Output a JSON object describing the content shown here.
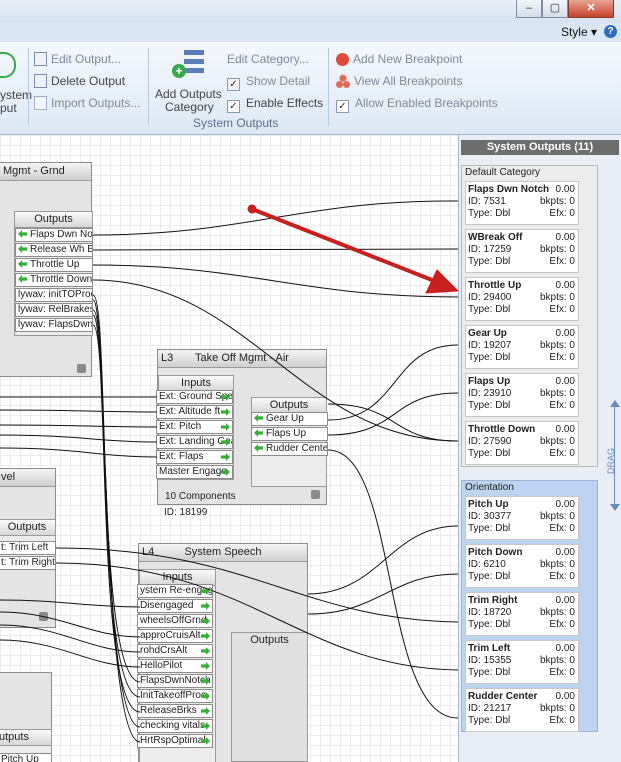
{
  "window": {
    "min": "–",
    "max": "▢",
    "close": "✕"
  },
  "menubar": {
    "style": "Style",
    "help": "?"
  },
  "ribbon": {
    "sys_partial_1": "ystem",
    "sys_partial_2": "put",
    "edit_output": "Edit Output...",
    "delete_output": "Delete Output",
    "import_outputs": "Import Outputs...",
    "add_outputs_category": "Add Outputs",
    "add_outputs_category_2": "Category",
    "edit_category": "Edit Category...",
    "show_detail": "Show Detail",
    "enable_effects": "Enable Effects",
    "add_new_breakpoint": "Add New Breakpoint",
    "view_all_breakpoints": "View All Breakpoints",
    "allow_enabled_breakpoints": "Allow Enabled Breakpoints",
    "group_label": "System Outputs",
    "show_detail_checked": false,
    "enable_effects_checked": true,
    "allow_enabled_checked": true
  },
  "nodes": {
    "grnd": {
      "title": "Mgmt - Grnd",
      "outputs_label": "Outputs",
      "outputs": [
        "Flaps Dwn Notch",
        "Release Wh Brk",
        "Throttle Up",
        "Throttle Down",
        "lywav: initTOProc",
        "lywav: RelBrakes",
        "lywav: FlapsDwn"
      ]
    },
    "l3": {
      "id": "L3",
      "title": "Take Off Mgmt - Air",
      "inputs_label": "Inputs",
      "inputs": [
        "Ext: Ground Speed",
        "Ext: Altitude ft",
        "Ext: Pitch",
        "Ext: Landing Gear",
        "Ext: Flaps",
        "Master Engage"
      ],
      "outputs_label": "Outputs",
      "outputs": [
        "Gear Up",
        "Flaps Up",
        "Rudder Center"
      ],
      "components": "10 Components",
      "node_id": "ID: 18199"
    },
    "vel": {
      "title": "vel",
      "outputs_label": "Outputs",
      "outputs": [
        "t: Trim Left",
        "t: Trim Right"
      ]
    },
    "l4": {
      "id": "L4",
      "title": "System Speech",
      "inputs_label": "Inputs",
      "inputs": [
        "ystem Re-engage",
        "Disengaged",
        "wheelsOffGrnd",
        "approCruisAlt",
        "rohdCrsAlt",
        "HelloPilot",
        "FlapsDwnNotch",
        "InitTakeoffProc",
        "ReleaseBrks",
        "checking vitals",
        "HrtRspOptimal"
      ],
      "outputs_label": "Outputs"
    },
    "bottom": {
      "outputs_label": "utputs",
      "outputs": [
        "Pitch Up"
      ]
    }
  },
  "sidebar": {
    "title": "System Outputs (11)",
    "drag": "DRAG",
    "groups": [
      {
        "name": "Default Category",
        "items": [
          {
            "name": "Flaps Dwn Notch",
            "value": "0.00",
            "id": "ID: 7531",
            "bkpts": "bkpts: 0",
            "type": "Type: Dbl",
            "efx": "Efx: 0"
          },
          {
            "name": "WBreak Off",
            "value": "0.00",
            "id": "ID: 17259",
            "bkpts": "bkpts: 0",
            "type": "Type: Dbl",
            "efx": "Efx: 0"
          },
          {
            "name": "Throttle Up",
            "value": "0.00",
            "id": "ID: 29400",
            "bkpts": "bkpts: 0",
            "type": "Type: Dbl",
            "efx": "Efx: 0"
          },
          {
            "name": "Gear Up",
            "value": "0.00",
            "id": "ID: 19207",
            "bkpts": "bkpts: 0",
            "type": "Type: Dbl",
            "efx": "Efx: 0"
          },
          {
            "name": "Flaps Up",
            "value": "0.00",
            "id": "ID: 23910",
            "bkpts": "bkpts: 0",
            "type": "Type: Dbl",
            "efx": "Efx: 0"
          },
          {
            "name": "Throttle Down",
            "value": "0.00",
            "id": "ID: 27590",
            "bkpts": "bkpts: 0",
            "type": "Type: Dbl",
            "efx": "Efx: 0"
          }
        ]
      },
      {
        "name": "Orientation",
        "items": [
          {
            "name": "Pitch Up",
            "value": "0.00",
            "id": "ID: 30377",
            "bkpts": "bkpts: 0",
            "type": "Type: Dbl",
            "efx": "Efx: 0"
          },
          {
            "name": "Pitch Down",
            "value": "0.00",
            "id": "ID: 6210",
            "bkpts": "bkpts: 0",
            "type": "Type: Dbl",
            "efx": "Efx: 0"
          },
          {
            "name": "Trim Right",
            "value": "0.00",
            "id": "ID: 18720",
            "bkpts": "bkpts: 0",
            "type": "Type: Dbl",
            "efx": "Efx: 0"
          },
          {
            "name": "Trim Left",
            "value": "0.00",
            "id": "ID: 15355",
            "bkpts": "bkpts: 0",
            "type": "Type: Dbl",
            "efx": "Efx: 0"
          },
          {
            "name": "Rudder Center",
            "value": "0.00",
            "id": "ID: 21217",
            "bkpts": "bkpts: 0",
            "type": "Type: Dbl",
            "efx": "Efx: 0"
          }
        ]
      }
    ]
  },
  "colors": {
    "accent_arrow": "#c8201e",
    "orientation_bg": "#bcd4f0",
    "default_bg": "#ececec",
    "port_arrow": "#35b035"
  }
}
